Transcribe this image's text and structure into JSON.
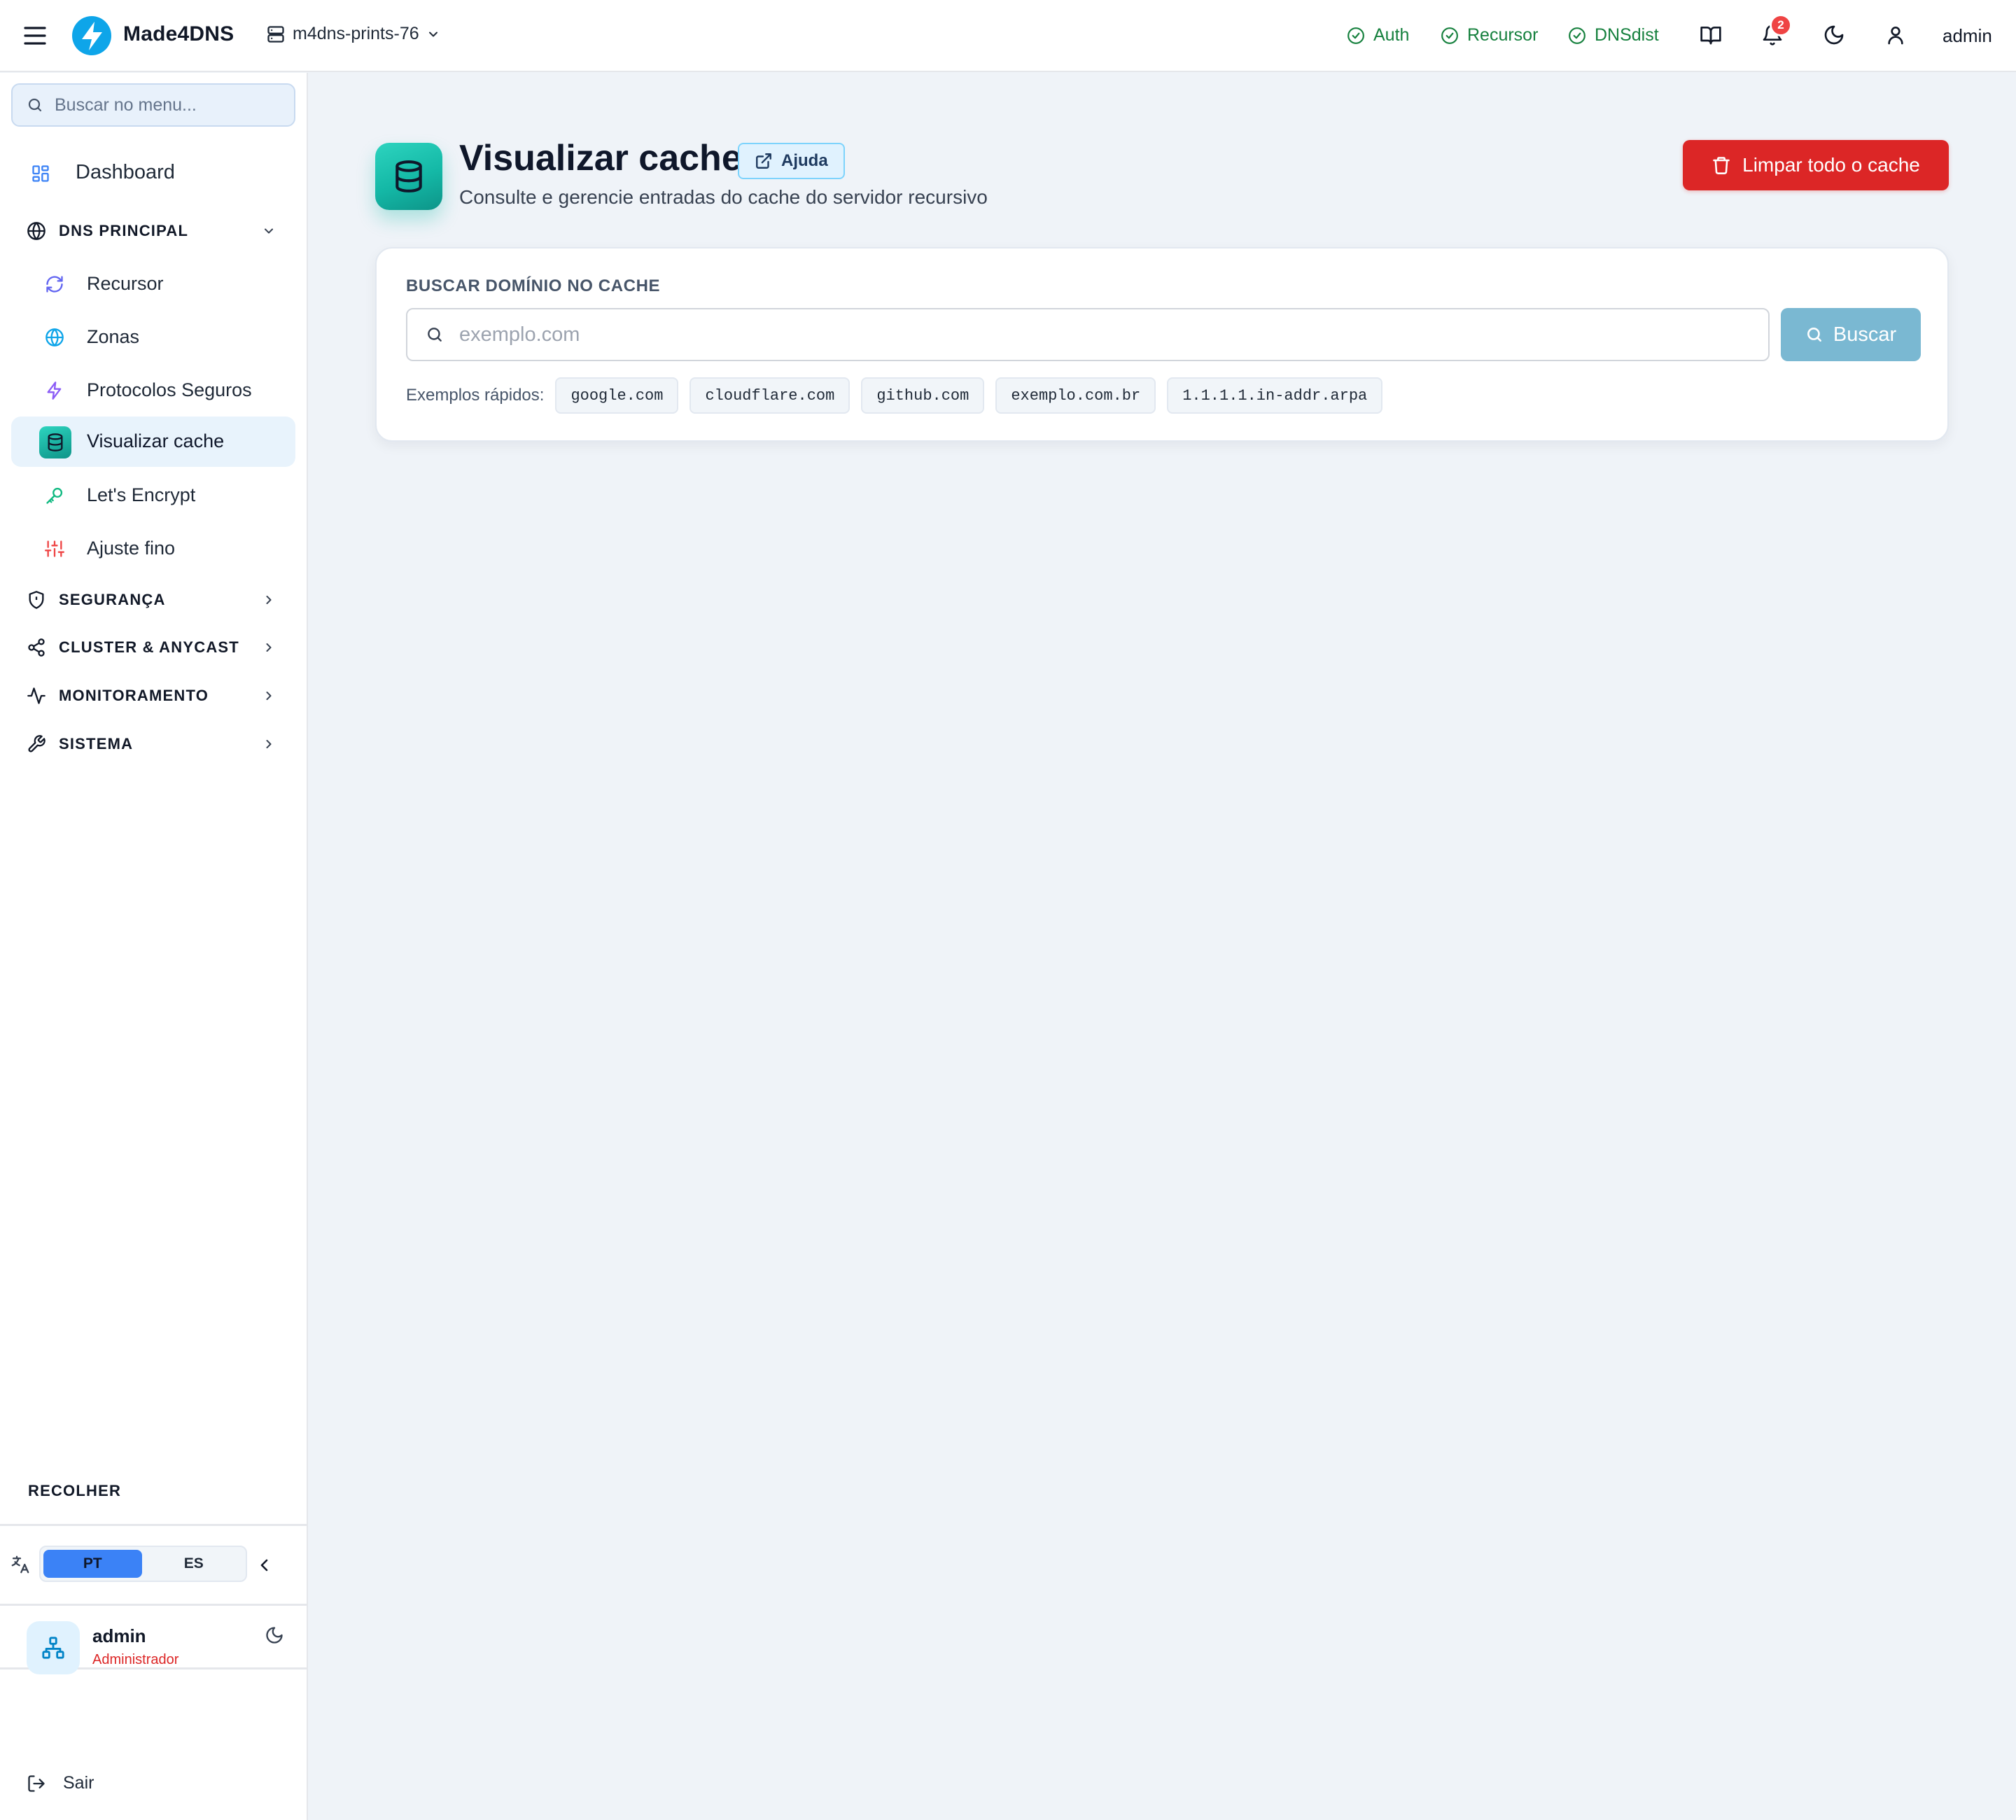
{
  "app": {
    "name": "Made4DNS",
    "server": "m4dns-prints-76"
  },
  "topbar": {
    "services": [
      {
        "label": "Auth",
        "status": "ok"
      },
      {
        "label": "Recursor",
        "status": "ok"
      },
      {
        "label": "DNSdist",
        "status": "ok"
      }
    ],
    "notifications_count": "2",
    "user": "admin"
  },
  "sidebar": {
    "search_placeholder": "Buscar no menu...",
    "dashboard": "Dashboard",
    "sections": {
      "dns_principal": "DNS PRINCIPAL",
      "seguranca": "SEGURANÇA",
      "cluster": "CLUSTER & ANYCAST",
      "monitoramento": "MONITORAMENTO",
      "sistema": "SISTEMA"
    },
    "dns_items": [
      {
        "label": "Recursor",
        "icon": "refresh-icon",
        "color": "#6366f1"
      },
      {
        "label": "Zonas",
        "icon": "globe-icon",
        "color": "#0ea5e9"
      },
      {
        "label": "Protocolos Seguros",
        "icon": "zap-icon",
        "color": "#8b5cf6"
      },
      {
        "label": "Visualizar cache",
        "icon": "database-icon",
        "color": "#14b8a6",
        "active": true
      },
      {
        "label": "Let's Encrypt",
        "icon": "key-icon",
        "color": "#10b981"
      },
      {
        "label": "Ajuste fino",
        "icon": "sliders-icon",
        "color": "#ef4444"
      }
    ],
    "collapse_label": "RECOLHER",
    "languages": [
      "PT",
      "ES"
    ],
    "active_language": "PT",
    "user": {
      "name": "admin",
      "role": "Administrador"
    },
    "logout": "Sair"
  },
  "page": {
    "title": "Visualizar cache",
    "help_label": "Ajuda",
    "subtitle": "Consulte e gerencie entradas do cache do servidor recursivo",
    "clear_label": "Limpar todo o cache"
  },
  "search": {
    "label": "BUSCAR DOMÍNIO NO CACHE",
    "placeholder": "exemplo.com",
    "value": "",
    "button": "Buscar",
    "examples_label": "Exemplos rápidos:",
    "examples": [
      "google.com",
      "cloudflare.com",
      "github.com",
      "exemplo.com.br",
      "1.1.1.1.in-addr.arpa"
    ]
  },
  "colors": {
    "accent": "#14b8a6",
    "danger": "#dc2626",
    "status_ok": "#15803d",
    "primary": "#3b82f6"
  }
}
